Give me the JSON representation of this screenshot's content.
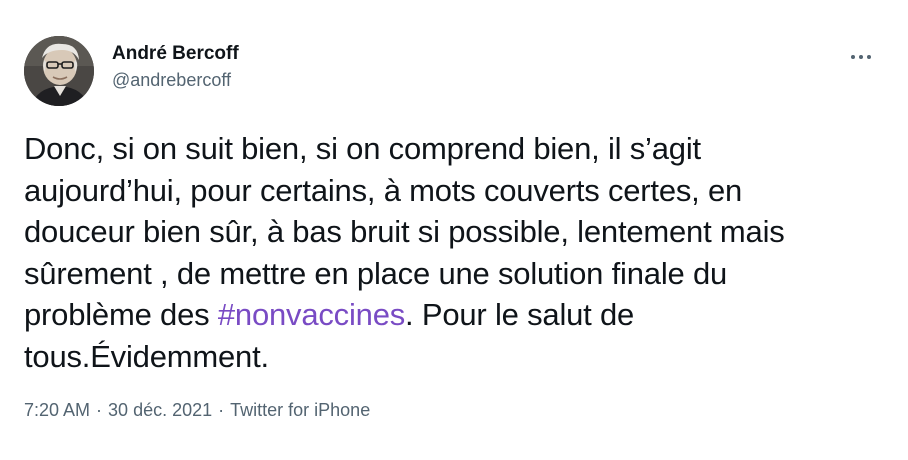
{
  "author": {
    "display_name": "André Bercoff",
    "handle": "@andrebercoff",
    "avatar_icon": "user-photo"
  },
  "menu_icon": "more-horizontal-icon",
  "tweet": {
    "line1": "Donc, si on suit bien, si on comprend bien, il s’agit",
    "line2": "aujourd’hui, pour certains, à mots couverts certes, en",
    "line3": "douceur bien sûr, à bas bruit si possible, lentement mais",
    "line4": "sûrement , de mettre en place une solution finale du",
    "line5_before": "problème des ",
    "hashtag": "#nonvaccines",
    "line5_after": ". Pour le salut de",
    "line6": "tous.Évidemment."
  },
  "meta": {
    "time": "7:20 AM",
    "separator": "·",
    "date": "30 déc. 2021",
    "source": "Twitter for iPhone"
  },
  "colors": {
    "hashtag": "#794bc4",
    "secondary_text": "#536471",
    "primary_text": "#0f1419"
  }
}
